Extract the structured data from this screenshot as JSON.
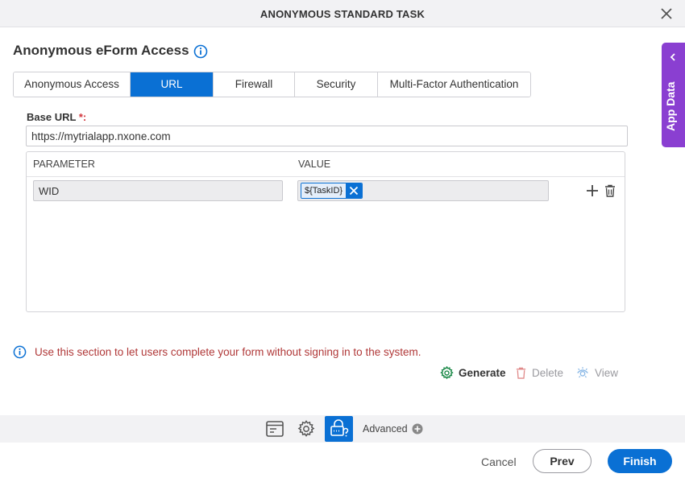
{
  "window": {
    "title": "ANONYMOUS STANDARD TASK"
  },
  "section": {
    "heading": "Anonymous eForm Access"
  },
  "tabs": [
    {
      "label": "Anonymous Access",
      "active": false
    },
    {
      "label": "URL",
      "active": true
    },
    {
      "label": "Firewall",
      "active": false
    },
    {
      "label": "Security",
      "active": false
    },
    {
      "label": "Multi-Factor Authentication",
      "active": false
    }
  ],
  "base_url": {
    "label": "Base URL",
    "required_mark": "*:",
    "value": "https://mytrialapp.nxone.com"
  },
  "params_table": {
    "headers": {
      "parameter": "PARAMETER",
      "value": "VALUE"
    },
    "rows": [
      {
        "parameter": "WID",
        "value_token": "${TaskID}"
      }
    ]
  },
  "info_note": "Use this section to let users complete your form without signing in to the system.",
  "actions": {
    "generate": "Generate",
    "delete": "Delete",
    "view": "View"
  },
  "toolbar": {
    "advanced": "Advanced"
  },
  "footer": {
    "cancel": "Cancel",
    "prev": "Prev",
    "finish": "Finish"
  },
  "side_panel": {
    "label": "App Data"
  },
  "colors": {
    "accent": "#0a70d4",
    "side_panel": "#8a3fd1",
    "note_text": "#b03838",
    "generate_icon": "#1e8a4a"
  },
  "icons": [
    "close-icon",
    "info-icon",
    "plus-icon",
    "trash-icon",
    "gear-icon",
    "view-icon",
    "form-icon",
    "settings-icon",
    "lock-question-icon",
    "add-circle-icon",
    "chevron-left-icon"
  ]
}
